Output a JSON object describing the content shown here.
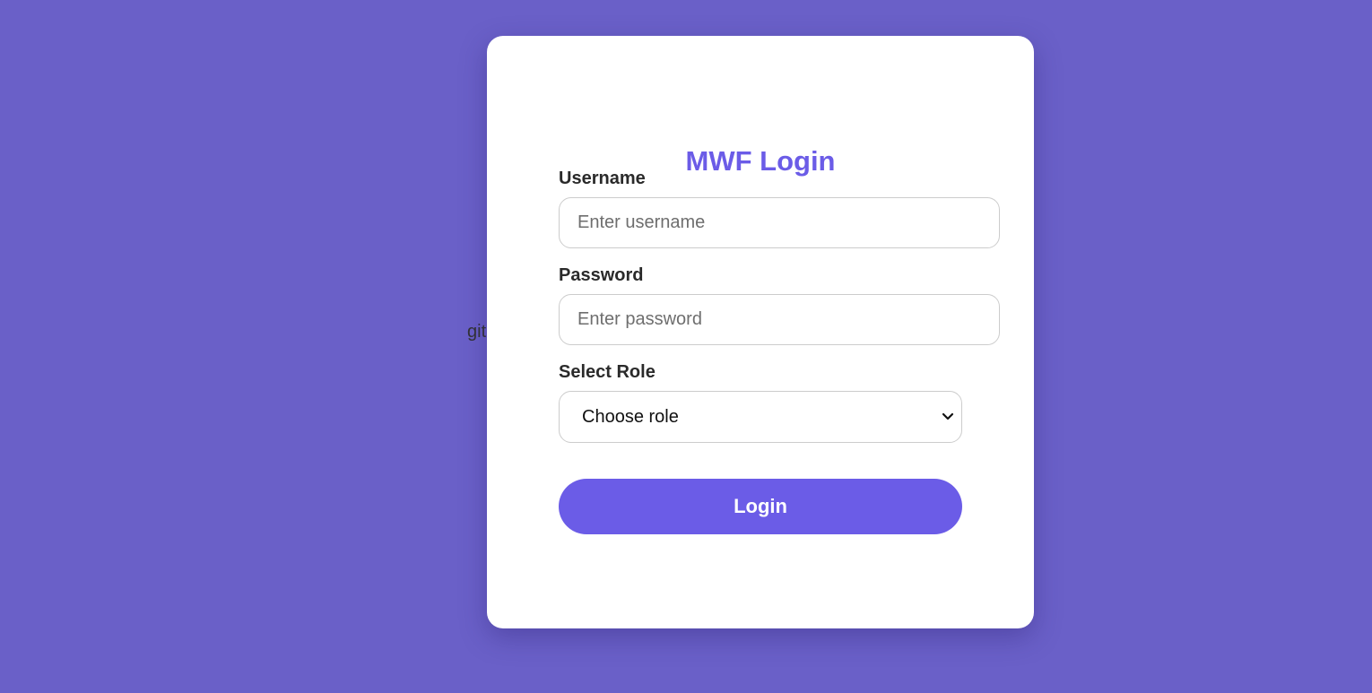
{
  "background": {
    "color": "#6a60c8",
    "stray_text": "git"
  },
  "login_card": {
    "title": "MWF Login",
    "title_color": "#6b5ce7",
    "username": {
      "label": "Username",
      "placeholder": "Enter username",
      "value": ""
    },
    "password": {
      "label": "Password",
      "placeholder": "Enter password",
      "value": ""
    },
    "role": {
      "label": "Select Role",
      "selected": "Choose role",
      "icon": "chevron-down-icon"
    },
    "submit": {
      "label": "Login",
      "color": "#6b5ce7"
    }
  }
}
